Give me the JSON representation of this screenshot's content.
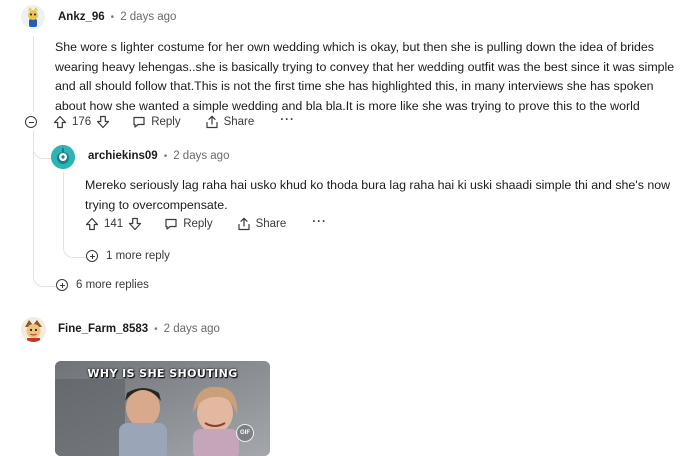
{
  "comments": [
    {
      "author": "Ankz_96",
      "time": "2 days ago",
      "body": "She wore s lighter costume for her own wedding which is okay, but then she is pulling down the idea of brides\nwearing heavy lehengas..she is basically trying to convey that her wedding outfit was the best since it was simple\nand all should follow that.This is not the first time she has highlighted this, in many interviews she has spoken\nabout how she wanted a simple wedding and bla bla.It is more like she was trying to prove this to the world",
      "votes": "176",
      "reply_label": "Reply",
      "share_label": "Share",
      "more_label": "···"
    },
    {
      "author": "archiekins09",
      "time": "2 days ago",
      "body": "Mereko seriously lag raha hai usko khud ko thoda bura lag raha hai ki uski shaadi simple thi and she's now\ntrying to overcompensate.",
      "votes": "141",
      "reply_label": "Reply",
      "share_label": "Share",
      "more_label": "···",
      "more_replies": "1 more reply"
    },
    {
      "author": "Fine_Farm_8583",
      "time": "2 days ago",
      "gif_caption": "WHY IS SHE SHOUTING",
      "gif_badge": "GIF"
    }
  ],
  "thread_more_replies": "6 more replies",
  "colors": {
    "thread_line": "#e0e3e6",
    "text": "#1c1c1c",
    "meta": "#6a6a6a",
    "avatar_teal": "#2bb5b5"
  },
  "icons": [
    "collapse-icon",
    "upvote-icon",
    "downvote-icon",
    "reply-icon",
    "share-icon",
    "overflow-icon",
    "expand-icon"
  ]
}
